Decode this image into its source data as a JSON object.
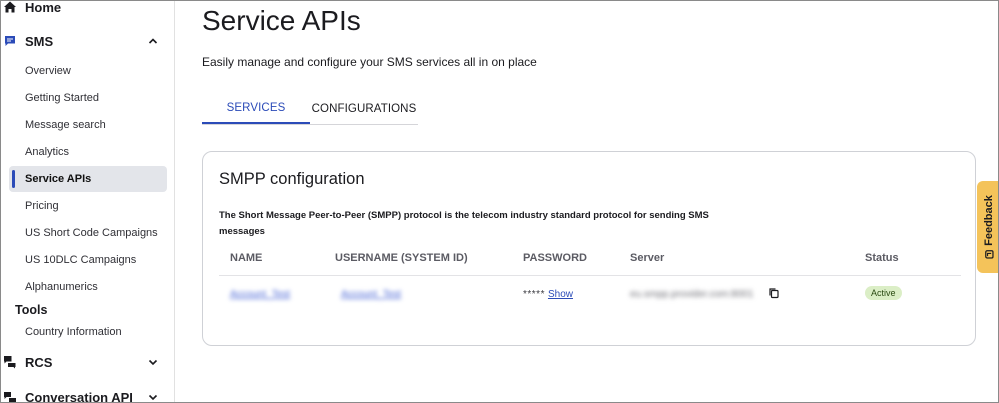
{
  "sidebar": {
    "home": "Home",
    "sms": "SMS",
    "sms_items": [
      "Overview",
      "Getting Started",
      "Message search",
      "Analytics",
      "Service APIs",
      "Pricing",
      "US Short Code Campaigns",
      "US 10DLC Campaigns",
      "Alphanumerics"
    ],
    "active_item": "Service APIs",
    "tools_heading": "Tools",
    "tools_items": [
      "Country Information"
    ],
    "rcs": "RCS",
    "conversation_api": "Conversation API"
  },
  "main": {
    "title": "Service APIs",
    "subtitle": "Easily manage and configure your SMS services all in on place",
    "tabs": [
      "SERVICES",
      "CONFIGURATIONS"
    ],
    "active_tab": "SERVICES"
  },
  "card": {
    "title": "SMPP configuration",
    "description": "The Short Message Peer-to-Peer (SMPP) protocol is the telecom industry standard protocol for sending SMS messages",
    "columns": [
      "NAME",
      "USERNAME (SYSTEM ID)",
      "PASSWORD",
      "Server",
      "Status"
    ],
    "row": {
      "name": "Account_Test",
      "username": "Account_Test",
      "password_mask": "*****",
      "show_label": "Show",
      "server": "eu.smpp.provider.com:8001",
      "status": "Active"
    }
  },
  "feedback": {
    "label": "Feedback"
  },
  "colors": {
    "accent": "#2b4bb8",
    "feedback_bg": "#f4c35a",
    "status_badge_bg": "#dbeec6"
  },
  "icons": {
    "home": "home-icon",
    "sms": "chat-bubble-icon",
    "rcs": "chat-bubbles-icon",
    "conversation": "conversation-icon",
    "copy": "copy-icon",
    "feedback": "feedback-icon"
  }
}
